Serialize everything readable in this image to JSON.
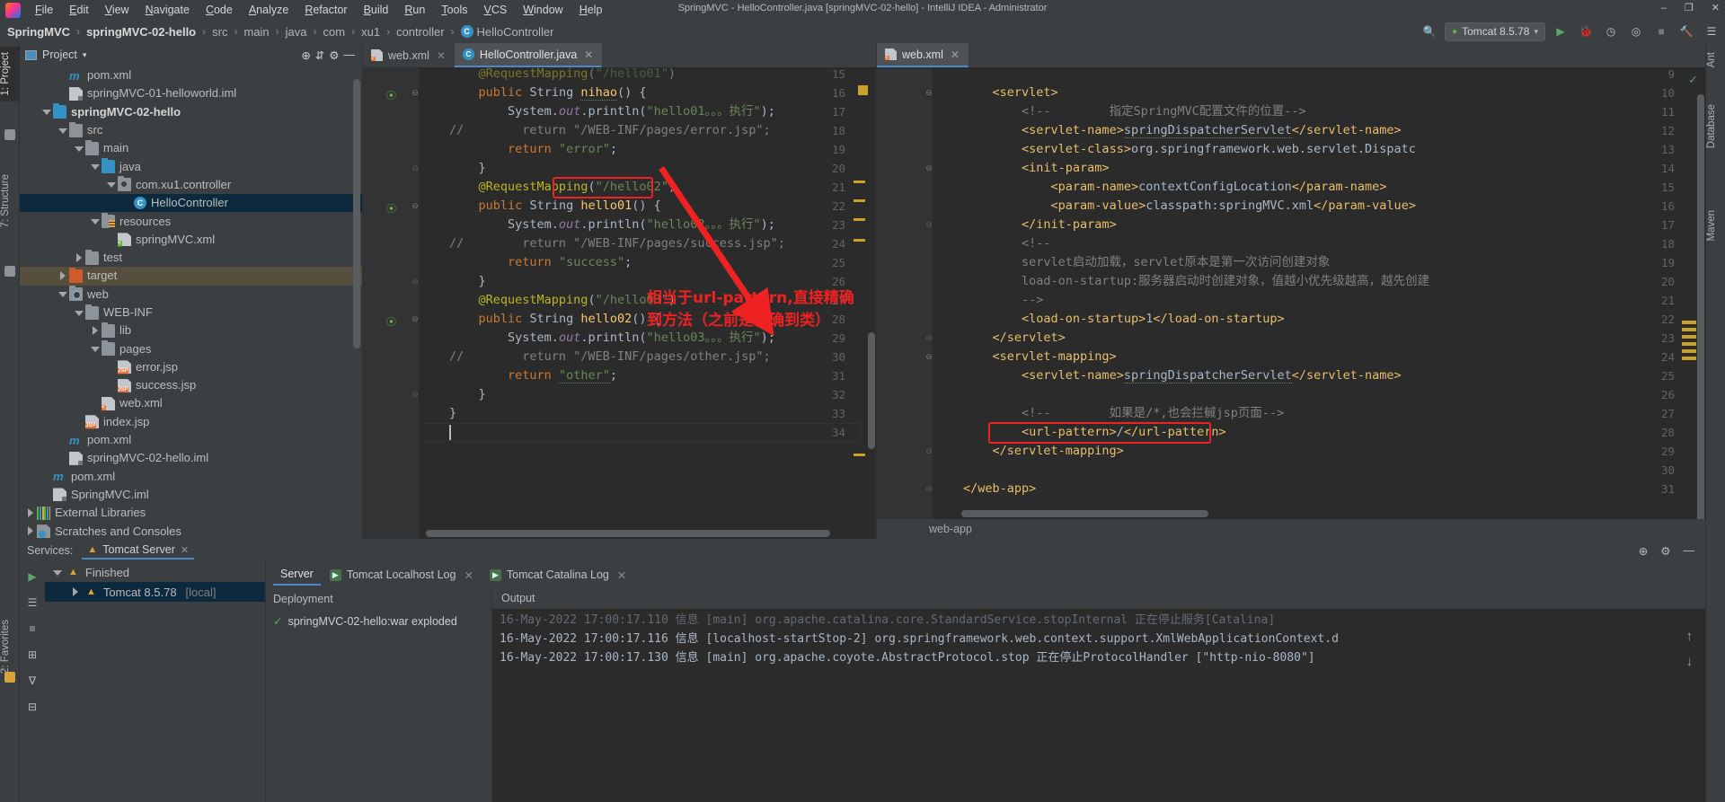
{
  "window": {
    "title": "SpringMVC - HelloController.java [springMVC-02-hello] - IntelliJ IDEA - Administrator",
    "minimize": "–",
    "maximize": "❐",
    "close": "✕"
  },
  "menu": {
    "items": [
      "File",
      "Edit",
      "View",
      "Navigate",
      "Code",
      "Analyze",
      "Refactor",
      "Build",
      "Run",
      "Tools",
      "VCS",
      "Window",
      "Help"
    ]
  },
  "breadcrumb": {
    "items": [
      {
        "label": "SpringMVC",
        "bold": true
      },
      {
        "label": "springMVC-02-hello",
        "bold": true
      },
      {
        "label": "src",
        "bold": false
      },
      {
        "label": "main",
        "bold": false
      },
      {
        "label": "java",
        "bold": false
      },
      {
        "label": "com",
        "bold": false
      },
      {
        "label": "xu1",
        "bold": false
      },
      {
        "label": "controller",
        "bold": false
      },
      {
        "label": "HelloController",
        "bold": false,
        "icon": "C"
      }
    ]
  },
  "toolbar": {
    "run_config": "Tomcat 8.5.78",
    "run_icon": "▶",
    "debug_icon": "🐞",
    "coverage_icon": "◷",
    "profile_icon": "◎",
    "stop_icon": "■",
    "build_icon": "🔨",
    "search_icon": "🔍",
    "updates_icon": "☰"
  },
  "left_strip": {
    "tabs": [
      "1: Project",
      "7: Structure",
      "2: Favorites"
    ]
  },
  "right_strip": {
    "tabs": [
      "Ant",
      "Database",
      "Maven"
    ]
  },
  "project_panel": {
    "title": "Project",
    "dropdown": "▾",
    "locate_icon": "⊕",
    "collapse_icon": "⇵",
    "settings_icon": "⚙",
    "hide_icon": "—",
    "tree": [
      {
        "indent": 2,
        "arrow": "none",
        "icon": "mvn",
        "label": "pom.xml",
        "bold": false,
        "state": "normal"
      },
      {
        "indent": 2,
        "arrow": "none",
        "icon": "iml",
        "label": "springMVC-01-helloworld.iml",
        "bold": false,
        "state": "normal"
      },
      {
        "indent": 1,
        "arrow": "down",
        "icon": "folderblue",
        "label": "springMVC-02-hello",
        "bold": true,
        "state": "normal"
      },
      {
        "indent": 2,
        "arrow": "down",
        "icon": "folder",
        "label": "src",
        "bold": false,
        "state": "normal"
      },
      {
        "indent": 3,
        "arrow": "down",
        "icon": "folder",
        "label": "main",
        "bold": false,
        "state": "normal"
      },
      {
        "indent": 4,
        "arrow": "down",
        "icon": "folderblue",
        "label": "java",
        "bold": false,
        "state": "normal"
      },
      {
        "indent": 5,
        "arrow": "down",
        "icon": "pkg",
        "label": "com.xu1.controller",
        "bold": false,
        "state": "normal"
      },
      {
        "indent": 6,
        "arrow": "none",
        "icon": "cls",
        "label": "HelloController",
        "bold": false,
        "state": "selected"
      },
      {
        "indent": 4,
        "arrow": "down",
        "icon": "folderres",
        "label": "resources",
        "bold": false,
        "state": "normal"
      },
      {
        "indent": 5,
        "arrow": "none",
        "icon": "spring",
        "label": "springMVC.xml",
        "bold": false,
        "state": "normal"
      },
      {
        "indent": 3,
        "arrow": "right",
        "icon": "folder",
        "label": "test",
        "bold": false,
        "state": "normal"
      },
      {
        "indent": 2,
        "arrow": "right",
        "icon": "folderorange",
        "label": "target",
        "bold": false,
        "state": "target"
      },
      {
        "indent": 2,
        "arrow": "down",
        "icon": "webf",
        "label": "web",
        "bold": false,
        "state": "normal"
      },
      {
        "indent": 3,
        "arrow": "down",
        "icon": "folder",
        "label": "WEB-INF",
        "bold": false,
        "state": "normal"
      },
      {
        "indent": 4,
        "arrow": "right",
        "icon": "folder",
        "label": "lib",
        "bold": false,
        "state": "normal"
      },
      {
        "indent": 4,
        "arrow": "down",
        "icon": "folder",
        "label": "pages",
        "bold": false,
        "state": "normal"
      },
      {
        "indent": 5,
        "arrow": "none",
        "icon": "jsp",
        "label": "error.jsp",
        "bold": false,
        "state": "normal"
      },
      {
        "indent": 5,
        "arrow": "none",
        "icon": "jsp",
        "label": "success.jsp",
        "bold": false,
        "state": "normal"
      },
      {
        "indent": 4,
        "arrow": "none",
        "icon": "xmlweb",
        "label": "web.xml",
        "bold": false,
        "state": "normal"
      },
      {
        "indent": 3,
        "arrow": "none",
        "icon": "jsp",
        "label": "index.jsp",
        "bold": false,
        "state": "normal"
      },
      {
        "indent": 2,
        "arrow": "none",
        "icon": "mvn",
        "label": "pom.xml",
        "bold": false,
        "state": "normal"
      },
      {
        "indent": 2,
        "arrow": "none",
        "icon": "iml",
        "label": "springMVC-02-hello.iml",
        "bold": false,
        "state": "normal"
      },
      {
        "indent": 1,
        "arrow": "none",
        "icon": "mvn",
        "label": "pom.xml",
        "bold": false,
        "state": "normal"
      },
      {
        "indent": 1,
        "arrow": "none",
        "icon": "iml",
        "label": "SpringMVC.iml",
        "bold": false,
        "state": "normal"
      },
      {
        "indent": 0,
        "arrow": "right",
        "icon": "lib",
        "label": "External Libraries",
        "bold": false,
        "state": "normal"
      },
      {
        "indent": 0,
        "arrow": "right",
        "icon": "scr",
        "label": "Scratches and Consoles",
        "bold": false,
        "state": "normal"
      }
    ]
  },
  "editor_left": {
    "tabs": [
      {
        "label": "web.xml",
        "icon": "xml",
        "active": false,
        "close": "✕"
      },
      {
        "label": "HelloController.java",
        "icon": "java",
        "active": true,
        "close": "✕"
      }
    ],
    "first_line_number": 15,
    "lines": [
      {
        "n": 15,
        "clipped": true,
        "html": "    <span class='ann'>@RequestMapping</span><span class='pln'>(</span><span class='str'>\"/hello01\"</span><span class='pln'>)</span>"
      },
      {
        "n": 16,
        "run": true,
        "fold": "open",
        "html": "    <span class='kw'>public</span> <span class='pln'>String</span> <span class='mth wavy'>nihao</span><span class='pln'>() {</span>"
      },
      {
        "n": 17,
        "html": "        <span class='pln'>System.</span><span class='fld'>out</span><span class='pln'>.println(</span><span class='str'>\"hello01。。。执行\"</span><span class='pln'>);</span>"
      },
      {
        "n": 18,
        "comment_slash": true,
        "html": "<span class='cmt'>          return \"/WEB-INF/pages/error.jsp\";</span>"
      },
      {
        "n": 19,
        "html": "        <span class='kw'>return</span> <span class='str'>\"error\"</span><span class='pln'>;</span>"
      },
      {
        "n": 20,
        "fold": "end",
        "html": "    <span class='pln'>}</span>"
      },
      {
        "n": 21,
        "html": "    <span class='ann'>@RequestMapping</span><span class='pln'>(</span><span class='str'>\"/hello02\"</span><span class='pln'>)</span>"
      },
      {
        "n": 22,
        "run": true,
        "fold": "open",
        "html": "    <span class='kw'>public</span> <span class='pln'>String</span> <span class='mth'>hello01</span><span class='pln'>() {</span>"
      },
      {
        "n": 23,
        "html": "        <span class='pln'>System.</span><span class='fld'>out</span><span class='pln'>.println(</span><span class='str'>\"hello02。。。执行\"</span><span class='pln'>);</span>"
      },
      {
        "n": 24,
        "comment_slash": true,
        "html": "<span class='cmt'>          return \"/WEB-INF/pages/success.jsp\";</span>"
      },
      {
        "n": 25,
        "html": "        <span class='kw'>return</span> <span class='str'>\"success\"</span><span class='pln'>;</span>"
      },
      {
        "n": 26,
        "fold": "end",
        "html": "    <span class='pln'>}</span>"
      },
      {
        "n": 27,
        "html": "    <span class='ann'>@RequestMapping</span><span class='pln'>(</span><span class='str'>\"/hello03\"</span><span class='pln'>)</span>"
      },
      {
        "n": 28,
        "run": true,
        "fold": "open",
        "html": "    <span class='kw'>public</span> <span class='pln'>String</span> <span class='mth'>hello02</span><span class='pln'>() {</span>"
      },
      {
        "n": 29,
        "html": "        <span class='pln'>System.</span><span class='fld'>out</span><span class='pln'>.println(</span><span class='str'>\"hello03。。。执行\"</span><span class='pln'>);</span>"
      },
      {
        "n": 30,
        "comment_slash": true,
        "html": "<span class='cmt'>          return \"/WEB-INF/pages/other.jsp\";</span>"
      },
      {
        "n": 31,
        "html": "        <span class='kw'>return</span> <span class='str wavy'>\"other\"</span><span class='pln'>;</span>"
      },
      {
        "n": 32,
        "fold": "end",
        "html": "    <span class='pln'>}</span>"
      },
      {
        "n": 33,
        "html": "<span class='pln'>}</span>"
      },
      {
        "n": 34,
        "html": ""
      }
    ],
    "annotation": {
      "text_line1": "相当于url-pattern,直接精确",
      "text_line2": "到方法（之前是精确到类）",
      "color": "#ee2222"
    },
    "highlight_box_label": "/hello02"
  },
  "editor_right": {
    "tabs": [
      {
        "label": "web.xml",
        "icon": "xml",
        "active": true,
        "close": "✕"
      }
    ],
    "breadcrumb": "web-app",
    "lines": [
      {
        "n": 9,
        "clipped": true,
        "html": ""
      },
      {
        "n": 10,
        "fold": "open",
        "html": "    <span class='tag'>&lt;servlet&gt;</span>"
      },
      {
        "n": 11,
        "html": "        <span class='cmt'>&lt;!--        指定SpringMVC配置文件的位置--&gt;</span>"
      },
      {
        "n": 12,
        "html": "        <span class='tag'>&lt;servlet-name&gt;</span><span class='pln wavy'>springDispatcherServlet</span><span class='tag'>&lt;/servlet-name&gt;</span>"
      },
      {
        "n": 13,
        "html": "        <span class='tag'>&lt;servlet-class&gt;</span><span class='pln'>org.springframework.web.servlet.Dispatc</span>"
      },
      {
        "n": 14,
        "fold": "open",
        "html": "        <span class='tag'>&lt;init-param&gt;</span>"
      },
      {
        "n": 15,
        "html": "            <span class='tag'>&lt;param-name&gt;</span><span class='pln'>contextConfigLocation</span><span class='tag'>&lt;/param-name&gt;</span>"
      },
      {
        "n": 16,
        "html": "            <span class='tag'>&lt;param-value&gt;</span><span class='pln'>classpath:springMVC.xml</span><span class='tag'>&lt;/param-value&gt;</span>"
      },
      {
        "n": 17,
        "fold": "end",
        "html": "        <span class='tag'>&lt;/init-param&gt;</span>"
      },
      {
        "n": 18,
        "html": "        <span class='cmt'>&lt;!--</span>"
      },
      {
        "n": 19,
        "html": "        <span class='cmt'>servlet启动加载，servlet原本是第一次访问创建对象</span>"
      },
      {
        "n": 20,
        "html": "        <span class='cmt'>load-on-startup:服务器启动时创建对象，值越小优先级越高，越先创建</span>"
      },
      {
        "n": 21,
        "html": "        <span class='cmt'>--&gt;</span>"
      },
      {
        "n": 22,
        "html": "        <span class='tag'>&lt;load-on-startup&gt;</span><span class='pln'>1</span><span class='tag'>&lt;/load-on-startup&gt;</span>"
      },
      {
        "n": 23,
        "fold": "end",
        "html": "    <span class='tag'>&lt;/servlet&gt;</span>"
      },
      {
        "n": 24,
        "fold": "open",
        "html": "    <span class='tag'>&lt;servlet-mapping&gt;</span>"
      },
      {
        "n": 25,
        "html": "        <span class='tag'>&lt;servlet-name&gt;</span><span class='pln wavy'>springDispatcherServlet</span><span class='tag'>&lt;/servlet-name&gt;</span>"
      },
      {
        "n": 26,
        "html": ""
      },
      {
        "n": 27,
        "html": "        <span class='cmt'>&lt;!--        如果是/*,也会拦戫jsp页面--&gt;</span>"
      },
      {
        "n": 28,
        "html": "        <span class='tag'>&lt;url-pattern&gt;</span><span class='pln'>/</span><span class='tag'>&lt;/url-pattern&gt;</span>"
      },
      {
        "n": 29,
        "fold": "end",
        "html": "    <span class='tag'>&lt;/servlet-mapping&gt;</span>"
      },
      {
        "n": 30,
        "html": ""
      },
      {
        "n": 31,
        "fold": "end",
        "html": "<span class='tag'>&lt;/web-app&gt;</span>"
      }
    ],
    "highlight_box_label": "<url-pattern>/</url-pattern>"
  },
  "services": {
    "title": "Services:",
    "tab_label": "Tomcat Server",
    "tab_close": "✕",
    "settings_icon": "⚙",
    "locate_icon": "⊕",
    "hide_icon": "—",
    "toolbar_icons": [
      "▶",
      "☰",
      "≡",
      "⊞",
      "∇",
      "⊟"
    ],
    "tree": [
      {
        "indent": 0,
        "arrow": "down",
        "icon": "tomcat",
        "label": "Finished",
        "sel": false
      },
      {
        "indent": 1,
        "arrow": "right",
        "icon": "tomcat",
        "label": "Tomcat 8.5.78",
        "suffix": "[local]",
        "sel": true
      }
    ],
    "tabs": [
      {
        "label": "Server",
        "active": true
      },
      {
        "label": "Tomcat Localhost Log",
        "active": false,
        "close": "✕"
      },
      {
        "label": "Tomcat Catalina Log",
        "active": false,
        "close": "✕"
      }
    ],
    "deployment": {
      "header": "Deployment",
      "item": "springMVC-02-hello:war exploded",
      "status_icon": "✓"
    },
    "output": {
      "header": "Output",
      "lines": [
        "16-May-2022 17:00:17.110 信息 [main] org.apache.catalina.core.StandardService.stopInternal 正在停止服务[Catalina]",
        "16-May-2022 17:00:17.116 信息 [localhost-startStop-2] org.springframework.web.context.support.XmlWebApplicationContext.d",
        "16-May-2022 17:00:17.130 信息 [main] org.apache.coyote.AbstractProtocol.stop 正在停止ProtocolHandler [\"http-nio-8080\"]"
      ]
    }
  },
  "status_icons": {
    "up_arrow": "↑",
    "down_arrow": "↓"
  }
}
